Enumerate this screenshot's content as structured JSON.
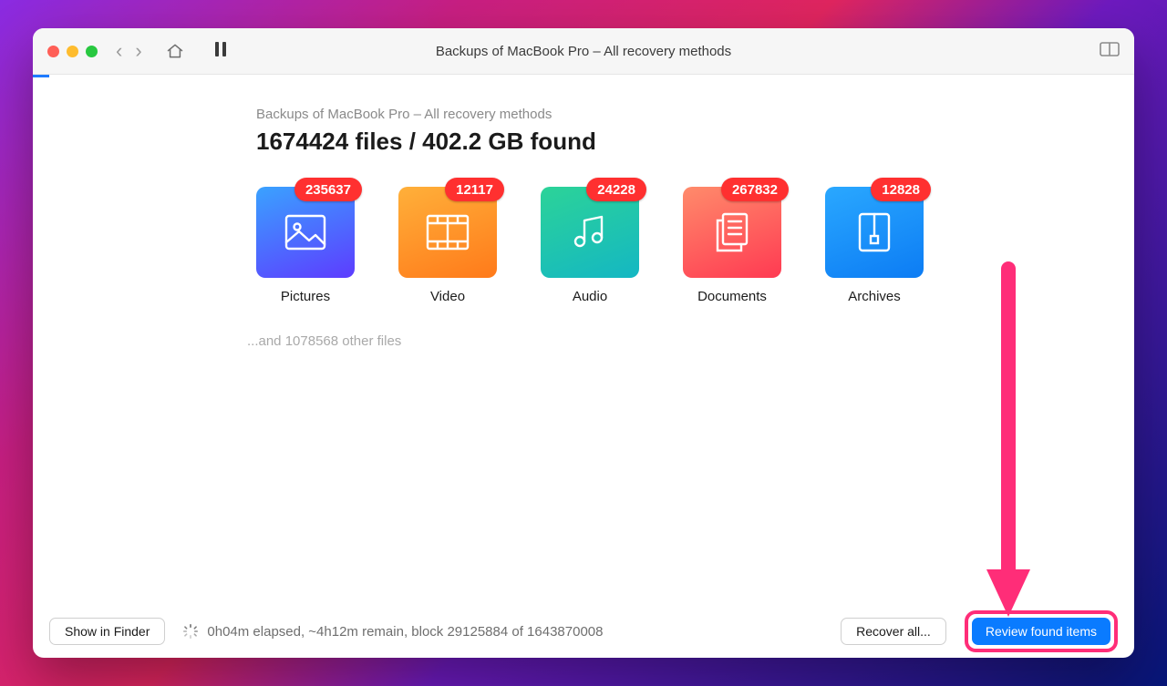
{
  "header": {
    "title": "Backups of MacBook Pro – All recovery methods"
  },
  "breadcrumb": "Backups of MacBook Pro – All recovery methods",
  "summary": "1674424 files / 402.2 GB found",
  "categories": [
    {
      "key": "pictures",
      "label": "Pictures",
      "count": "235637"
    },
    {
      "key": "video",
      "label": "Video",
      "count": "12117"
    },
    {
      "key": "audio",
      "label": "Audio",
      "count": "24228"
    },
    {
      "key": "documents",
      "label": "Documents",
      "count": "267832"
    },
    {
      "key": "archives",
      "label": "Archives",
      "count": "12828"
    }
  ],
  "other_files_line": "...and 1078568 other files",
  "status": {
    "text": "0h04m elapsed, ~4h12m remain, block 29125884 of 1643870008"
  },
  "footer": {
    "show_in_finder": "Show in Finder",
    "recover_all": "Recover all...",
    "review": "Review found items"
  }
}
